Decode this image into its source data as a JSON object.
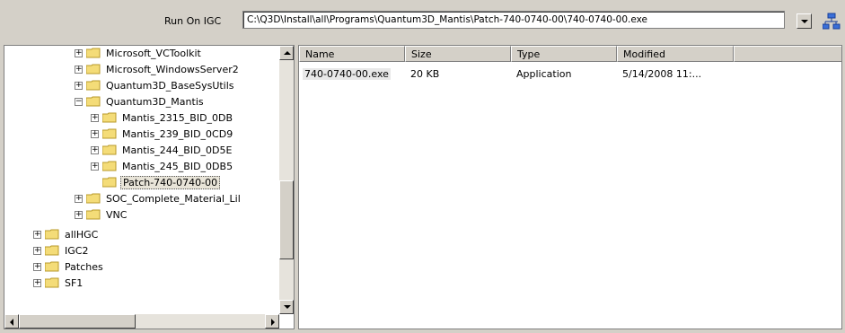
{
  "toolbar": {
    "run_label": "Run On IGC",
    "path_value": "C:\\Q3D\\Install\\all\\Programs\\Quantum3D_Mantis\\Patch-740-0740-00\\740-0740-00.exe"
  },
  "tree": {
    "items": [
      {
        "label": "Microsoft_VCToolkit"
      },
      {
        "label": "Microsoft_WindowsServer2"
      },
      {
        "label": "Quantum3D_BaseSysUtils"
      },
      {
        "label": "Quantum3D_Mantis"
      },
      {
        "label": "Mantis_2315_BID_0DB"
      },
      {
        "label": "Mantis_239_BID_0CD9"
      },
      {
        "label": "Mantis_244_BID_0D5E"
      },
      {
        "label": "Mantis_245_BID_0DB5"
      },
      {
        "label": "Patch-740-0740-00"
      },
      {
        "label": "SOC_Complete_Material_Lil"
      },
      {
        "label": "VNC"
      },
      {
        "label": "allHGC"
      },
      {
        "label": "IGC2"
      },
      {
        "label": "Patches"
      },
      {
        "label": "SF1"
      }
    ]
  },
  "list": {
    "columns": [
      "Name",
      "Size",
      "Type",
      "Modified"
    ],
    "rows": [
      {
        "name": "740-0740-00.exe",
        "size": "20 KB",
        "type": "Application",
        "modified": "5/14/2008 11:..."
      }
    ]
  },
  "colors": {
    "folder": "#f4dc78",
    "folder_edge": "#b89a2a",
    "window_bg": "#d4d0c8"
  }
}
